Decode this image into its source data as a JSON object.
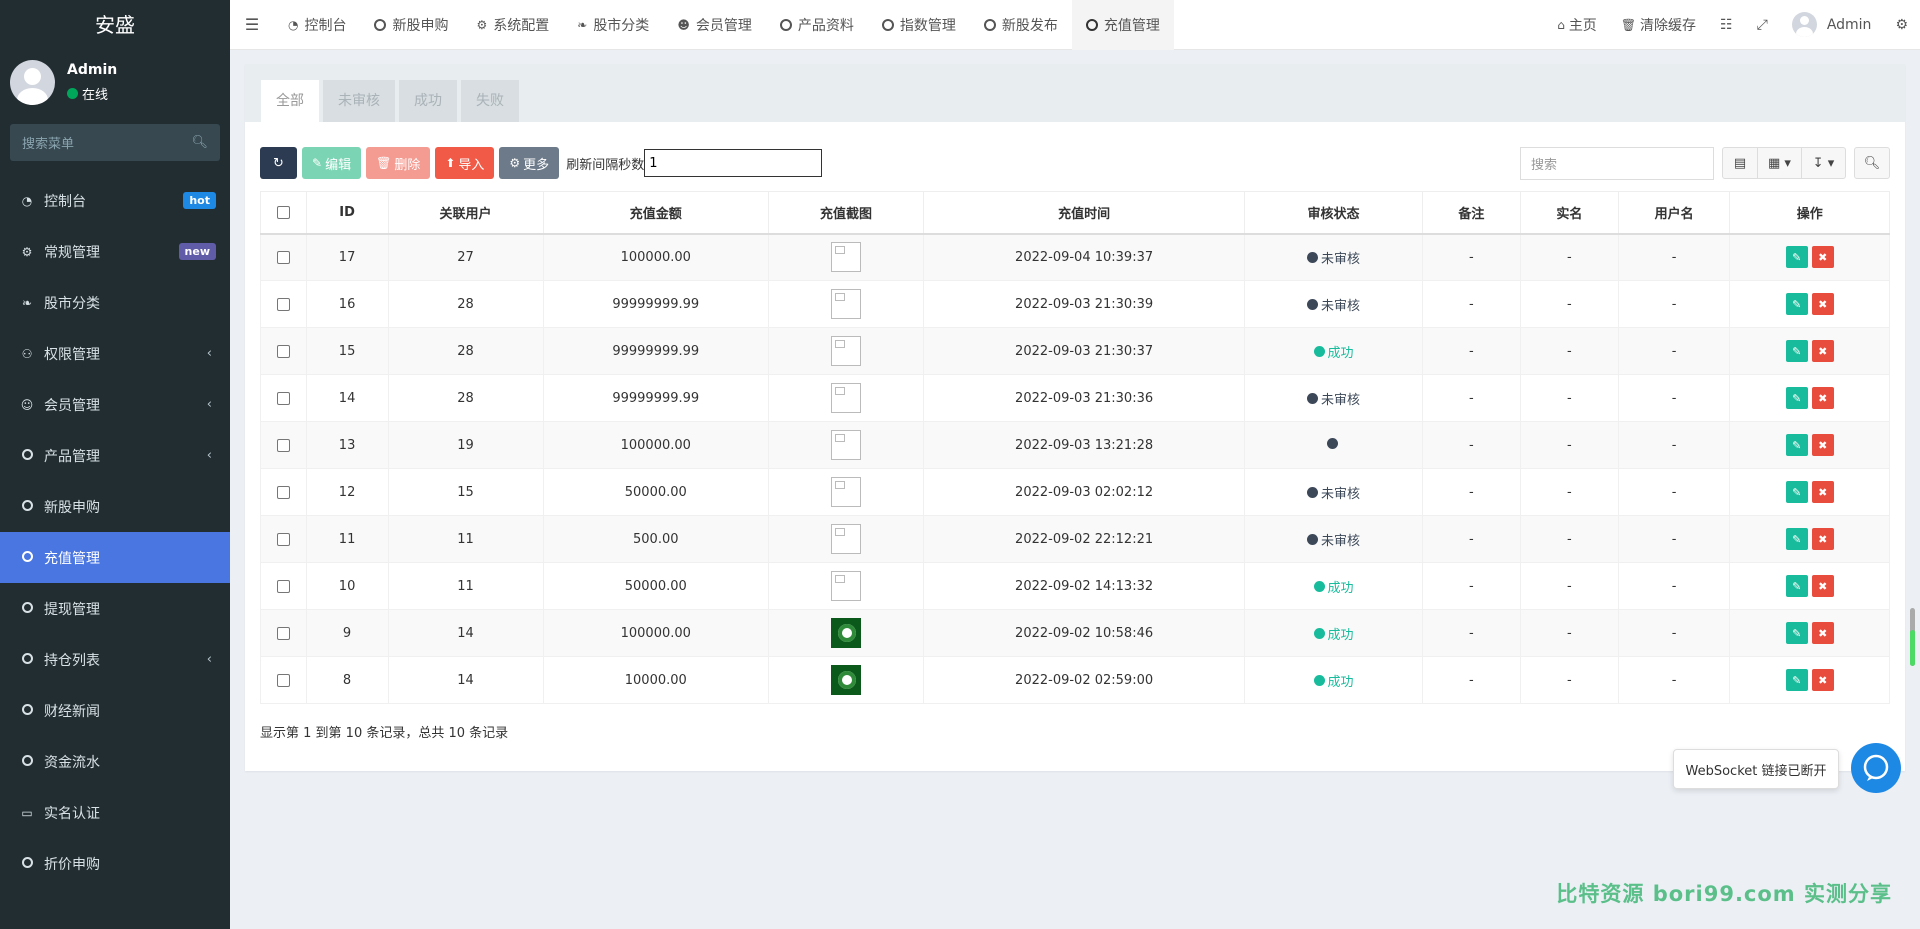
{
  "app": {
    "brand": "安盛"
  },
  "user": {
    "name": "Admin",
    "status": "在线"
  },
  "sidebar": {
    "search_placeholder": "搜索菜单",
    "items": [
      {
        "label": "控制台",
        "icon": "dashboard-icon",
        "badge": "hot"
      },
      {
        "label": "常规管理",
        "icon": "cogs-icon",
        "badge": "new"
      },
      {
        "label": "股市分类",
        "icon": "leaf-icon"
      },
      {
        "label": "权限管理",
        "icon": "group-icon",
        "expand": true
      },
      {
        "label": "会员管理",
        "icon": "user-circle-icon",
        "expand": true
      },
      {
        "label": "产品管理",
        "icon": "circle-icon",
        "expand": true
      },
      {
        "label": "新股申购",
        "icon": "circle-icon"
      },
      {
        "label": "充值管理",
        "icon": "circle-icon",
        "active": true
      },
      {
        "label": "提现管理",
        "icon": "circle-icon"
      },
      {
        "label": "持仓列表",
        "icon": "circle-icon",
        "expand": true
      },
      {
        "label": "财经新闻",
        "icon": "circle-icon"
      },
      {
        "label": "资金流水",
        "icon": "circle-icon"
      },
      {
        "label": "实名认证",
        "icon": "credit-card-icon"
      },
      {
        "label": "折价申购",
        "icon": "circle-icon"
      }
    ]
  },
  "topnav": {
    "tabs": [
      {
        "label": "控制台",
        "icon": "dashboard-icon"
      },
      {
        "label": "新股申购",
        "icon": "circle-icon"
      },
      {
        "label": "系统配置",
        "icon": "gear-icon"
      },
      {
        "label": "股市分类",
        "icon": "leaf-icon"
      },
      {
        "label": "会员管理",
        "icon": "user-icon"
      },
      {
        "label": "产品资料",
        "icon": "circle-icon"
      },
      {
        "label": "指数管理",
        "icon": "circle-icon"
      },
      {
        "label": "新股发布",
        "icon": "circle-icon"
      },
      {
        "label": "充值管理",
        "icon": "circle-icon",
        "active": true
      }
    ],
    "home": "主页",
    "clear_cache": "清除缓存",
    "user": "Admin"
  },
  "subtabs": [
    "全部",
    "未审核",
    "成功",
    "失败"
  ],
  "toolbar": {
    "edit": "编辑",
    "delete": "删除",
    "import": "导入",
    "more": "更多",
    "refresh_label": "刷新间隔秒数",
    "refresh_value": "1",
    "search_placeholder": "搜索"
  },
  "table": {
    "headers": [
      "ID",
      "关联用户",
      "充值金额",
      "充值截图",
      "充值时间",
      "审核状态",
      "备注",
      "实名",
      "用户名",
      "操作"
    ],
    "rows": [
      {
        "id": "17",
        "user": "27",
        "amount": "100000.00",
        "img": "broken",
        "time": "2022-09-04 10:39:37",
        "status": "未审核",
        "status_type": "pending",
        "note": "-",
        "realname": "-",
        "username": "-"
      },
      {
        "id": "16",
        "user": "28",
        "amount": "99999999.99",
        "img": "broken",
        "time": "2022-09-03 21:30:39",
        "status": "未审核",
        "status_type": "pending",
        "note": "-",
        "realname": "-",
        "username": "-"
      },
      {
        "id": "15",
        "user": "28",
        "amount": "99999999.99",
        "img": "broken",
        "time": "2022-09-03 21:30:37",
        "status": "成功",
        "status_type": "ok",
        "note": "-",
        "realname": "-",
        "username": "-"
      },
      {
        "id": "14",
        "user": "28",
        "amount": "99999999.99",
        "img": "broken",
        "time": "2022-09-03 21:30:36",
        "status": "未审核",
        "status_type": "pending",
        "note": "-",
        "realname": "-",
        "username": "-"
      },
      {
        "id": "13",
        "user": "19",
        "amount": "100000.00",
        "img": "broken",
        "time": "2022-09-03 13:21:28",
        "status": "",
        "status_type": "pending",
        "note": "-",
        "realname": "-",
        "username": "-"
      },
      {
        "id": "12",
        "user": "15",
        "amount": "50000.00",
        "img": "broken",
        "time": "2022-09-03 02:02:12",
        "status": "未审核",
        "status_type": "pending",
        "note": "-",
        "realname": "-",
        "username": "-"
      },
      {
        "id": "11",
        "user": "11",
        "amount": "500.00",
        "img": "broken",
        "time": "2022-09-02 22:12:21",
        "status": "未审核",
        "status_type": "pending",
        "note": "-",
        "realname": "-",
        "username": "-"
      },
      {
        "id": "10",
        "user": "11",
        "amount": "50000.00",
        "img": "broken",
        "time": "2022-09-02 14:13:32",
        "status": "成功",
        "status_type": "ok",
        "note": "-",
        "realname": "-",
        "username": "-"
      },
      {
        "id": "9",
        "user": "14",
        "amount": "100000.00",
        "img": "image",
        "time": "2022-09-02 10:58:46",
        "status": "成功",
        "status_type": "ok",
        "note": "-",
        "realname": "-",
        "username": "-"
      },
      {
        "id": "8",
        "user": "14",
        "amount": "10000.00",
        "img": "image",
        "time": "2022-09-02 02:59:00",
        "status": "成功",
        "status_type": "ok",
        "note": "-",
        "realname": "-",
        "username": "-"
      }
    ]
  },
  "pagination": {
    "summary": "显示第 1 到第 10 条记录，总共 10 条记录"
  },
  "websocket": {
    "message": "WebSocket 链接已断开"
  },
  "watermark": "比特资源 bori99.com 实测分享",
  "colors": {
    "sidebar_bg": "#222d32",
    "active": "#4a76e1",
    "success": "#18bc9c",
    "danger": "#e74c3c"
  }
}
